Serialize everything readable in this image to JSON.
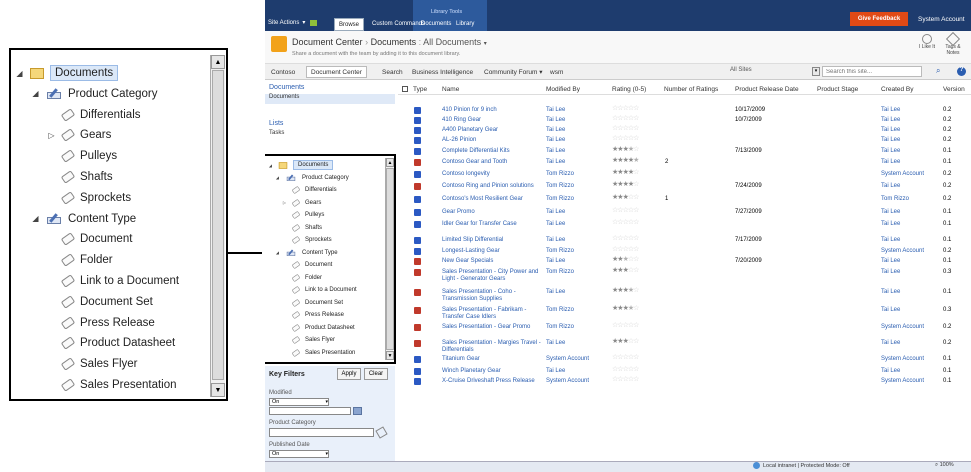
{
  "topbar": {
    "site_actions": "Site Actions",
    "tabs": [
      "Browse",
      "Custom Commands",
      "Documents",
      "Library"
    ],
    "tools_label": "Library Tools",
    "give_feedback": "Give Feedback",
    "account": "System Account"
  },
  "title": {
    "main": "Document Center",
    "sep": "›",
    "lib": "Documents",
    "view": "All Documents",
    "sub": "Share a document with the team by adding it to this document library."
  },
  "actions": {
    "like": "I Like It",
    "tags": "Tags & Notes"
  },
  "nav": {
    "tabs": [
      "Contoso",
      "Document Center",
      "Search",
      "Business Intelligence",
      "Community Forum ▾",
      "wsm"
    ],
    "scope": "All Sites",
    "search_placeholder": "Search this site..."
  },
  "quicklaunch": {
    "items": [
      "Documents",
      "Documents",
      "Lists",
      "Tasks"
    ]
  },
  "tree": [
    {
      "label": "Documents",
      "icon": "folder-icon",
      "level": 0,
      "exp": "open"
    },
    {
      "label": "Product Category",
      "icon": "pencil-icon",
      "level": 1,
      "exp": "open"
    },
    {
      "label": "Differentials",
      "icon": "tag-icon",
      "level": 2,
      "exp": ""
    },
    {
      "label": "Gears",
      "icon": "tag-icon",
      "level": 2,
      "exp": "closed"
    },
    {
      "label": "Pulleys",
      "icon": "tag-icon",
      "level": 2,
      "exp": ""
    },
    {
      "label": "Shafts",
      "icon": "tag-icon",
      "level": 2,
      "exp": ""
    },
    {
      "label": "Sprockets",
      "icon": "tag-icon",
      "level": 2,
      "exp": ""
    },
    {
      "label": "Content Type",
      "icon": "pencil-icon",
      "level": 1,
      "exp": "open"
    },
    {
      "label": "Document",
      "icon": "tag-icon",
      "level": 2,
      "exp": ""
    },
    {
      "label": "Folder",
      "icon": "tag-icon",
      "level": 2,
      "exp": ""
    },
    {
      "label": "Link to a Document",
      "icon": "tag-icon",
      "level": 2,
      "exp": ""
    },
    {
      "label": "Document Set",
      "icon": "tag-icon",
      "level": 2,
      "exp": ""
    },
    {
      "label": "Press Release",
      "icon": "tag-icon",
      "level": 2,
      "exp": ""
    },
    {
      "label": "Product Datasheet",
      "icon": "tag-icon",
      "level": 2,
      "exp": ""
    },
    {
      "label": "Sales Flyer",
      "icon": "tag-icon",
      "level": 2,
      "exp": ""
    },
    {
      "label": "Sales Presentation",
      "icon": "tag-icon",
      "level": 2,
      "exp": ""
    }
  ],
  "keyfilters": {
    "title": "Key Filters",
    "apply": "Apply",
    "clear": "Clear",
    "modified": "Modified",
    "on": "On",
    "product_category": "Product Category",
    "published_date": "Published Date"
  },
  "table": {
    "headers": [
      "Type",
      "Name",
      "Modified By",
      "Rating (0-5)",
      "Number of Ratings",
      "Product Release Date",
      "Product Stage",
      "Created By",
      "Version"
    ],
    "rows": [
      {
        "name": "410 Pinion for 9 inch",
        "mod": "Tai Lee",
        "rating": 0,
        "nr": "",
        "rel": "10/17/2009",
        "cre": "Tai Lee",
        "ver": "0.2",
        "pdf": false
      },
      {
        "name": "410 Ring Gear",
        "mod": "Tai Lee",
        "rating": 0,
        "nr": "",
        "rel": "10/7/2009",
        "cre": "Tai Lee",
        "ver": "0.2",
        "pdf": false
      },
      {
        "name": "A400 Planetary Gear",
        "mod": "Tai Lee",
        "rating": 0,
        "nr": "",
        "rel": "",
        "cre": "Tai Lee",
        "ver": "0.2",
        "pdf": false
      },
      {
        "name": "AL-26 Pinion",
        "mod": "Tai Lee",
        "rating": 0,
        "nr": "",
        "rel": "",
        "cre": "Tai Lee",
        "ver": "0.2",
        "pdf": false
      },
      {
        "name": "Complete Differential Kits",
        "mod": "Tai Lee",
        "rating": 3.5,
        "nr": "",
        "rel": "7/13/2009",
        "cre": "Tai Lee",
        "ver": "0.1",
        "pdf": false
      },
      {
        "name": "Contoso Gear and Tooth",
        "mod": "Tai Lee",
        "rating": 4.5,
        "nr": "2",
        "rel": "",
        "cre": "Tai Lee",
        "ver": "0.1",
        "pdf": true
      },
      {
        "name": "Contoso longevity",
        "mod": "Tom Rizzo",
        "rating": 4,
        "nr": "",
        "rel": "",
        "cre": "System Account",
        "ver": "0.2",
        "pdf": false
      },
      {
        "name": "Contoso Ring and Pinion solutions",
        "mod": "Tom Rizzo",
        "rating": 4,
        "nr": "",
        "rel": "7/24/2009",
        "cre": "Tai Lee",
        "ver": "0.2",
        "pdf": true
      },
      {
        "name": "Contoso's Most Resilient Gear",
        "mod": "Tom Rizzo",
        "rating": 3,
        "nr": "1",
        "rel": "",
        "cre": "Tom Rizzo",
        "ver": "0.2",
        "pdf": false
      },
      {
        "name": "Gear Promo",
        "mod": "Tai Lee",
        "rating": 0,
        "nr": "",
        "rel": "7/27/2009",
        "cre": "Tai Lee",
        "ver": "0.1",
        "pdf": false
      },
      {
        "name": "Idler Gear for Transfer Case",
        "mod": "Tai Lee",
        "rating": 0,
        "nr": "",
        "rel": "",
        "cre": "Tai Lee",
        "ver": "0.1",
        "pdf": false
      },
      {
        "name": "Limited Slip Differential",
        "mod": "Tai Lee",
        "rating": 0,
        "nr": "",
        "rel": "7/17/2009",
        "cre": "Tai Lee",
        "ver": "0.1",
        "pdf": false
      },
      {
        "name": "Longest-Lasting Gear",
        "mod": "Tom Rizzo",
        "rating": 0,
        "nr": "",
        "rel": "",
        "cre": "System Account",
        "ver": "0.2",
        "pdf": false
      },
      {
        "name": "New Gear Specials",
        "mod": "Tai Lee",
        "rating": 2.5,
        "nr": "",
        "rel": "7/20/2009",
        "cre": "Tai Lee",
        "ver": "0.1",
        "pdf": true
      },
      {
        "name": "Sales Presentation - City Power and Light - Generator Gears",
        "mod": "Tom Rizzo",
        "rating": 3,
        "nr": "",
        "rel": "",
        "cre": "Tai Lee",
        "ver": "0.3",
        "pdf": true
      },
      {
        "name": "Sales Presentation - Coho - Transmission Supplies",
        "mod": "Tai Lee",
        "rating": 3.5,
        "nr": "",
        "rel": "",
        "cre": "Tai Lee",
        "ver": "0.1",
        "pdf": true
      },
      {
        "name": "Sales Presentation - Fabrikam - Transfer Case Idlers",
        "mod": "Tom Rizzo",
        "rating": 3.5,
        "nr": "",
        "rel": "",
        "cre": "Tai Lee",
        "ver": "0.3",
        "pdf": true
      },
      {
        "name": "Sales Presentation - Gear Promo",
        "mod": "Tom Rizzo",
        "rating": 0,
        "nr": "",
        "rel": "",
        "cre": "System Account",
        "ver": "0.2",
        "pdf": true
      },
      {
        "name": "Sales Presentation - Margies Travel - Differentials",
        "mod": "Tai Lee",
        "rating": 3,
        "nr": "",
        "rel": "",
        "cre": "Tai Lee",
        "ver": "0.2",
        "pdf": true
      },
      {
        "name": "Titanium Gear",
        "mod": "System Account",
        "rating": 0,
        "nr": "",
        "rel": "",
        "cre": "System Account",
        "ver": "0.1",
        "pdf": false
      },
      {
        "name": "Winch Planetary Gear",
        "mod": "Tai Lee",
        "rating": 0,
        "nr": "",
        "rel": "",
        "cre": "Tai Lee",
        "ver": "0.1",
        "pdf": false
      },
      {
        "name": "X-Cruise Driveshaft Press Release",
        "mod": "System Account",
        "rating": 0,
        "nr": "",
        "rel": "",
        "cre": "System Account",
        "ver": "0.1",
        "pdf": false
      }
    ]
  },
  "statusbar": {
    "zone": "Local intranet | Protected Mode: Off",
    "zoom": "100%"
  },
  "colors": {
    "ribbon": "#1e3c6e",
    "feedback": "#e04a16",
    "link": "#2a5db0"
  }
}
